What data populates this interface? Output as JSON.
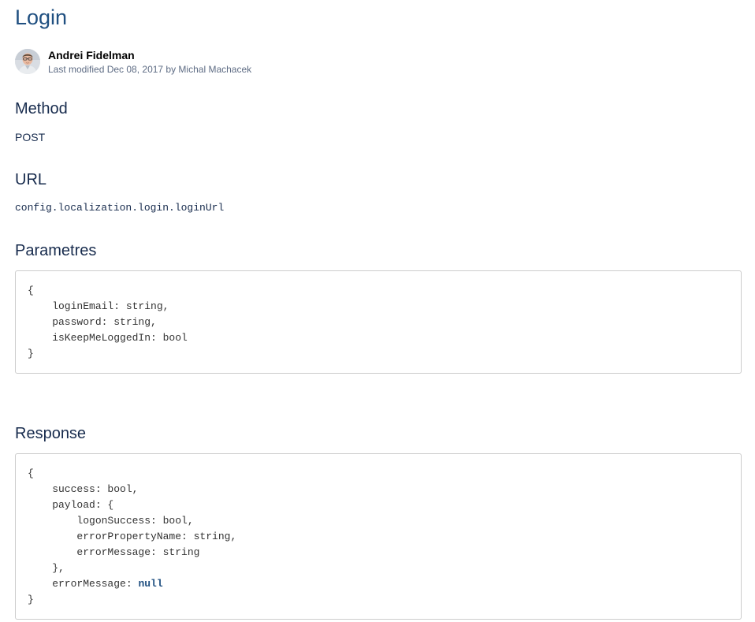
{
  "page": {
    "title": "Login"
  },
  "byline": {
    "author": "Andrei Fidelman",
    "modified": "Last modified Dec 08, 2017 by Michal Machacek"
  },
  "sections": {
    "method": {
      "heading": "Method",
      "value": "POST"
    },
    "url": {
      "heading": "URL",
      "value": "config.localization.login.loginUrl"
    },
    "parameters": {
      "heading": "Parametres",
      "code_lines": [
        "{",
        "    loginEmail: string,",
        "    password: string,",
        "    isKeepMeLoggedIn: bool",
        "}"
      ]
    },
    "response": {
      "heading": "Response",
      "code_lines": [
        "{",
        "    success: bool,",
        "    payload: {",
        "        logonSuccess: bool,",
        "        errorPropertyName: string,",
        "        errorMessage: string",
        "    },",
        "    errorMessage: ",
        "}"
      ],
      "null_keyword": "null"
    }
  },
  "colors": {
    "title": "#205081",
    "text": "#172b4d",
    "meta": "#5e6c84",
    "code_border": "#cccccc",
    "keyword": "#205081"
  },
  "icons": {
    "avatar": "user-avatar-photo"
  }
}
